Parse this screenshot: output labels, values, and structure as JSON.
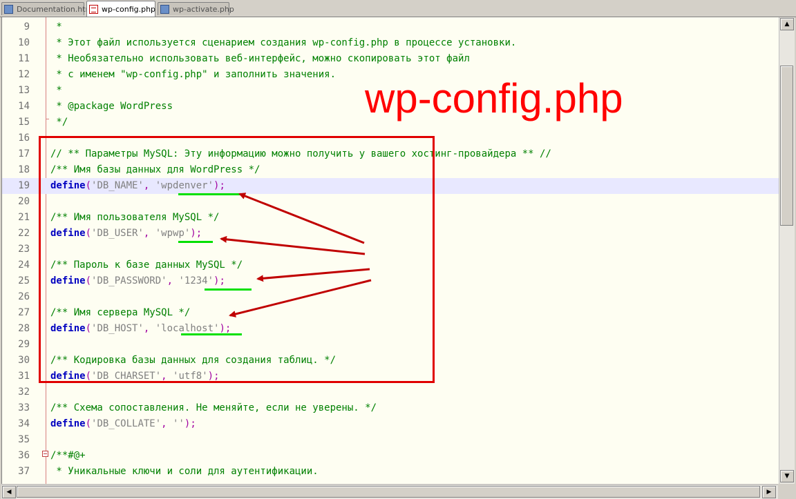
{
  "tabs": [
    {
      "label": "Documentation.html",
      "active": false
    },
    {
      "label": "wp-config.php",
      "active": true
    },
    {
      "label": "wp-activate.php",
      "active": false
    }
  ],
  "editor": {
    "current_line": 19,
    "lines": [
      {
        "n": "9",
        "text": " *"
      },
      {
        "n": "10",
        "text": " * Этот файл используется сценарием создания wp-config.php в процессе установки."
      },
      {
        "n": "11",
        "text": " * Необязательно использовать веб-интерфейс, можно скопировать этот файл"
      },
      {
        "n": "12",
        "text": " * с именем \"wp-config.php\" и заполнить значения."
      },
      {
        "n": "13",
        "text": " *"
      },
      {
        "n": "14",
        "text": " * @package WordPress"
      },
      {
        "n": "15",
        "text": " */"
      },
      {
        "n": "16",
        "text": ""
      },
      {
        "n": "17",
        "text": "// ** Параметры MySQL: Эту информацию можно получить у вашего хостинг-провайдера ** //"
      },
      {
        "n": "18",
        "text": "/** Имя базы данных для WordPress */"
      },
      {
        "n": "19",
        "text": "define('DB_NAME', 'wpdenver');"
      },
      {
        "n": "20",
        "text": ""
      },
      {
        "n": "21",
        "text": "/** Имя пользователя MySQL */"
      },
      {
        "n": "22",
        "text": "define('DB_USER', 'wpwp');"
      },
      {
        "n": "23",
        "text": ""
      },
      {
        "n": "24",
        "text": "/** Пароль к базе данных MySQL */"
      },
      {
        "n": "25",
        "text": "define('DB_PASSWORD', '1234');"
      },
      {
        "n": "26",
        "text": ""
      },
      {
        "n": "27",
        "text": "/** Имя сервера MySQL */"
      },
      {
        "n": "28",
        "text": "define('DB_HOST', 'localhost');"
      },
      {
        "n": "29",
        "text": ""
      },
      {
        "n": "30",
        "text": "/** Кодировка базы данных для создания таблиц. */"
      },
      {
        "n": "31",
        "text": "define('DB_CHARSET', 'utf8');"
      },
      {
        "n": "32",
        "text": ""
      },
      {
        "n": "33",
        "text": "/** Схема сопоставления. Не меняйте, если не уверены. */"
      },
      {
        "n": "34",
        "text": "define('DB_COLLATE', '');"
      },
      {
        "n": "35",
        "text": ""
      },
      {
        "n": "36",
        "text": "/**#@+"
      },
      {
        "n": "37",
        "text": " * Уникальные ключи и соли для аутентификации."
      }
    ]
  },
  "overlay": {
    "title": "wp-config.php",
    "box_color": "#e00000",
    "underline_color": "#00e000",
    "arrow_color": "#c00000"
  },
  "colors": {
    "comment": "#008000",
    "keyword": "#0000c0",
    "string": "#808080",
    "punctuation": "#a000a0",
    "background": "#fefef2",
    "current_line": "#e8e8ff"
  },
  "icons": {
    "tab_file": "file-icon",
    "scroll_up": "arrow-up-icon",
    "scroll_down": "arrow-down-icon",
    "scroll_left": "arrow-left-icon",
    "scroll_right": "arrow-right-icon"
  }
}
